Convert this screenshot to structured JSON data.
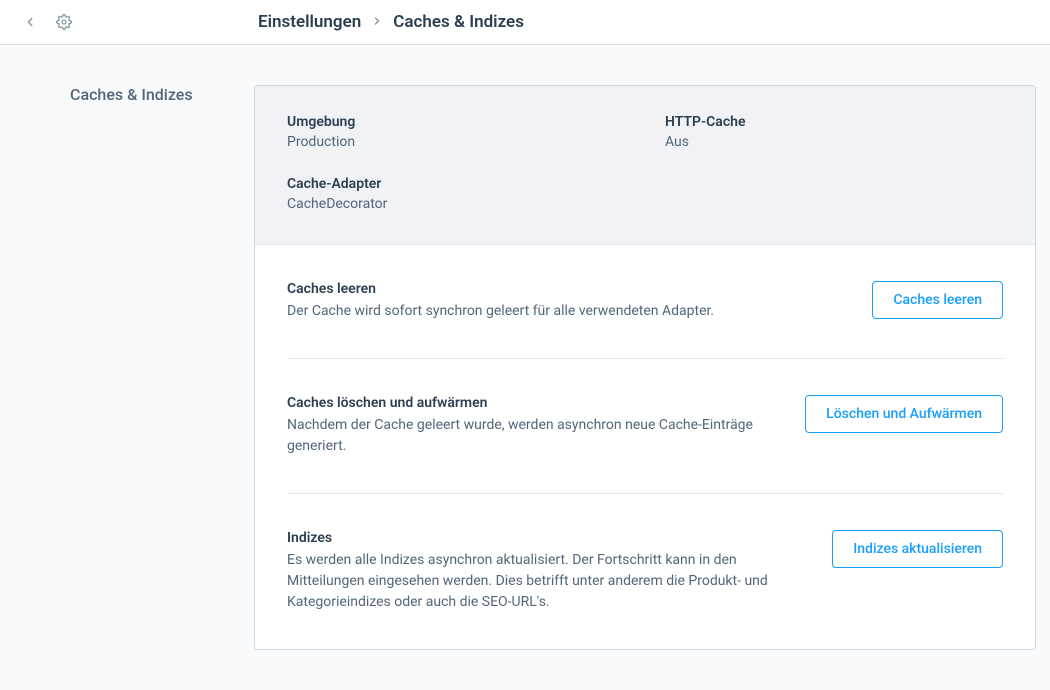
{
  "breadcrumb": {
    "root": "Einstellungen",
    "current": "Caches & Indizes"
  },
  "sidebar": {
    "title": "Caches & Indizes"
  },
  "overview": {
    "environment_label": "Umgebung",
    "environment_value": "Production",
    "http_cache_label": "HTTP-Cache",
    "http_cache_value": "Aus",
    "cache_adapter_label": "Cache-Adapter",
    "cache_adapter_value": "CacheDecorator"
  },
  "actions": {
    "clear": {
      "title": "Caches leeren",
      "desc": "Der Cache wird sofort synchron geleert für alle verwendeten Adapter.",
      "button": "Caches leeren"
    },
    "warmup": {
      "title": "Caches löschen und aufwärmen",
      "desc": "Nachdem der Cache geleert wurde, werden asynchron neue Cache-Einträge generiert.",
      "button": "Löschen und Aufwärmen"
    },
    "indexes": {
      "title": "Indizes",
      "desc": "Es werden alle Indizes asynchron aktualisiert. Der Fortschritt kann in den Mitteilungen eingesehen werden. Dies betrifft unter anderem die Produkt- und Kategorieindizes oder auch die SEO-URL's.",
      "button": "Indizes aktualisieren"
    }
  }
}
